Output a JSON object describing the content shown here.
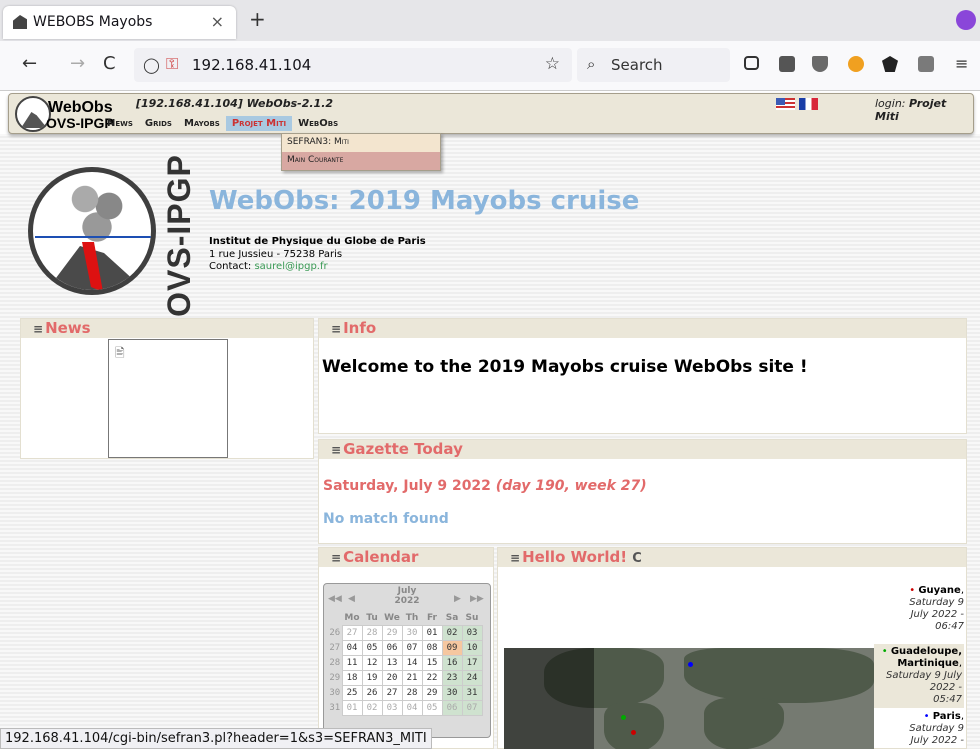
{
  "browser": {
    "tab_title": "WEBOBS Mayobs",
    "tab_close": "×",
    "new_tab": "+",
    "back": "←",
    "forward": "→",
    "reload": "C",
    "url": "192.168.41.104",
    "search_placeholder": "Search",
    "menu": "≡",
    "status_url": "192.168.41.104/cgi-bin/sefran3.pl?header=1&s3=SEFRAN3_MITI"
  },
  "header": {
    "brand_line1": "WebObs",
    "brand_line2": "OVS-IPGP",
    "host_version": "[192.168.41.104]  WebObs-2.1.2",
    "menu": [
      "News",
      "Grids",
      "Mayobs",
      "Projet Miti",
      "WebObs"
    ],
    "active_menu": "Projet Miti",
    "login_label": "login:",
    "login_user": "Projet Miti",
    "dropdown": [
      "SEFRAN3: Miti",
      "Main Courante"
    ]
  },
  "site": {
    "logo_text": "OVS-IPGP",
    "title": "WebObs: 2019 Mayobs cruise",
    "institute": "Institut de Physique du Globe de Paris",
    "address": "1 rue Jussieu - 75238 Paris",
    "contact_label": "Contact:",
    "contact_email": "saurel@ipgp.fr"
  },
  "panels": {
    "icon": "≡",
    "news": "News",
    "info": "Info",
    "welcome": "Welcome to the 2019 Mayobs cruise WebObs site !",
    "gazette": "Gazette Today",
    "gazette_date": "Saturday, July 9 2022",
    "gazette_day": "(day 190, week 27)",
    "no_match": "No match found",
    "calendar": "Calendar",
    "hello": "Hello World!",
    "hello_refresh": "C"
  },
  "calendar": {
    "month": "July",
    "year": "2022",
    "weekdays": [
      "Mo",
      "Tu",
      "We",
      "Th",
      "Fr",
      "Sa",
      "Su"
    ],
    "weeks": [
      {
        "wk": "26",
        "days": [
          "27",
          "28",
          "29",
          "30",
          "01",
          "02",
          "03"
        ]
      },
      {
        "wk": "27",
        "days": [
          "04",
          "05",
          "06",
          "07",
          "08",
          "09",
          "10"
        ]
      },
      {
        "wk": "28",
        "days": [
          "11",
          "12",
          "13",
          "14",
          "15",
          "16",
          "17"
        ]
      },
      {
        "wk": "29",
        "days": [
          "18",
          "19",
          "20",
          "21",
          "22",
          "23",
          "24"
        ]
      },
      {
        "wk": "30",
        "days": [
          "25",
          "26",
          "27",
          "28",
          "29",
          "30",
          "31"
        ]
      },
      {
        "wk": "31",
        "days": [
          "01",
          "02",
          "03",
          "04",
          "05",
          "06",
          "07"
        ]
      }
    ]
  },
  "clocks": [
    {
      "name": "Guyane",
      "date": "Saturday 9 July 2022 -",
      "time": "06:47"
    },
    {
      "name": "Guadeloupe, Martinique",
      "date": "Saturday 9 July 2022 -",
      "time": "05:47"
    },
    {
      "name": "Paris",
      "date": "Saturday 9 July 2022 -",
      "time": ""
    }
  ],
  "colors": {
    "accent_red": "#e26a6a",
    "accent_blue": "#8ab5dc",
    "panel_header": "#ebe7d9",
    "menu_active": "#a9c9e1"
  }
}
